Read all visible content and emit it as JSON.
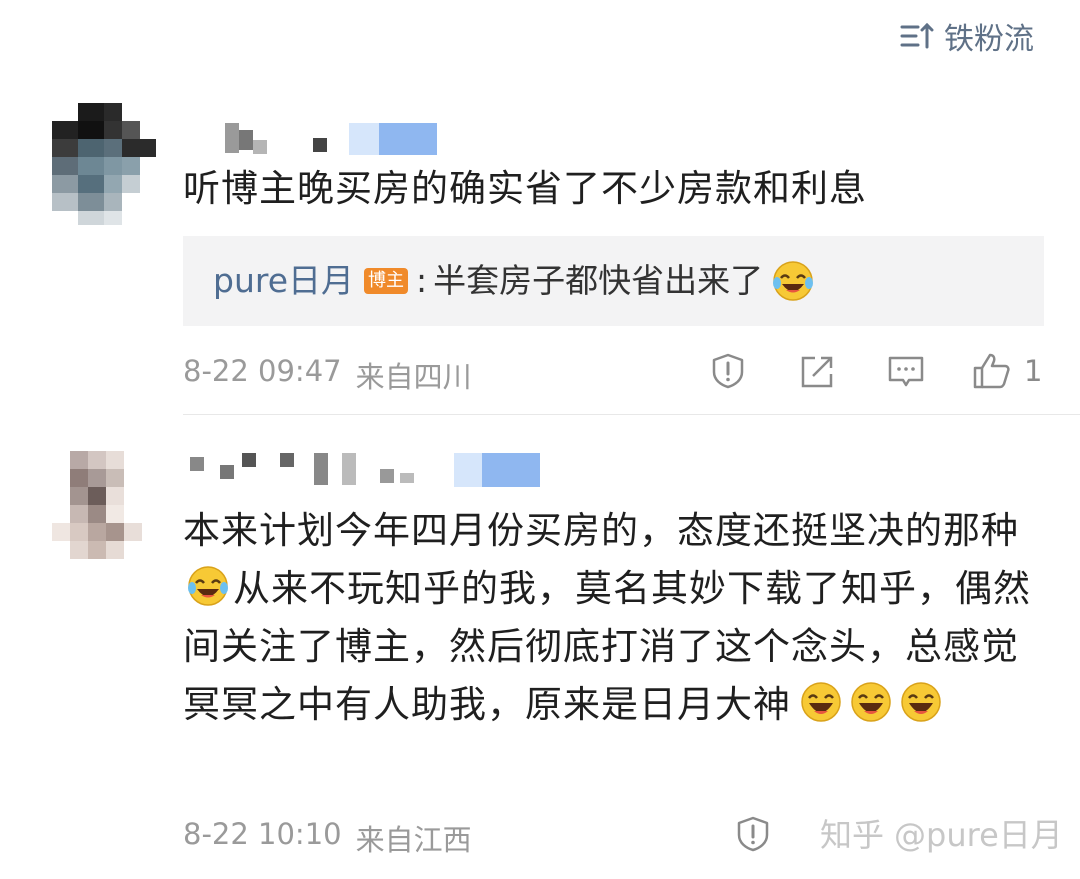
{
  "header": {
    "fans_label": "铁粉流"
  },
  "comments": [
    {
      "text": "听博主晚买房的确实省了不少房款和利息",
      "reply": {
        "user": "pure日月",
        "badge": "博主",
        "separator": ":",
        "text": "半套房子都快省出来了"
      },
      "time": "8-22 09:47",
      "location": "来自四川",
      "like_count": "1"
    },
    {
      "text_parts": [
        "本来计划今年四月份买房的，态度还挺坚决的那种",
        "从来不玩知乎的我，莫名其妙下载了知乎，偶然间关注了博主，然后彻底打消了这个念头，总感觉冥冥之中有人助我，原来是日月大神"
      ],
      "time": "8-22 10:10",
      "location": "来自江西"
    }
  ],
  "watermark": {
    "site": "知乎",
    "handle": "@pure日月"
  },
  "icons": {
    "sort": "sort-icon",
    "report": "report-icon",
    "repost": "repost-icon",
    "reply": "comment-icon",
    "like": "like-icon",
    "emoji": "laugh-cry-emoji"
  }
}
